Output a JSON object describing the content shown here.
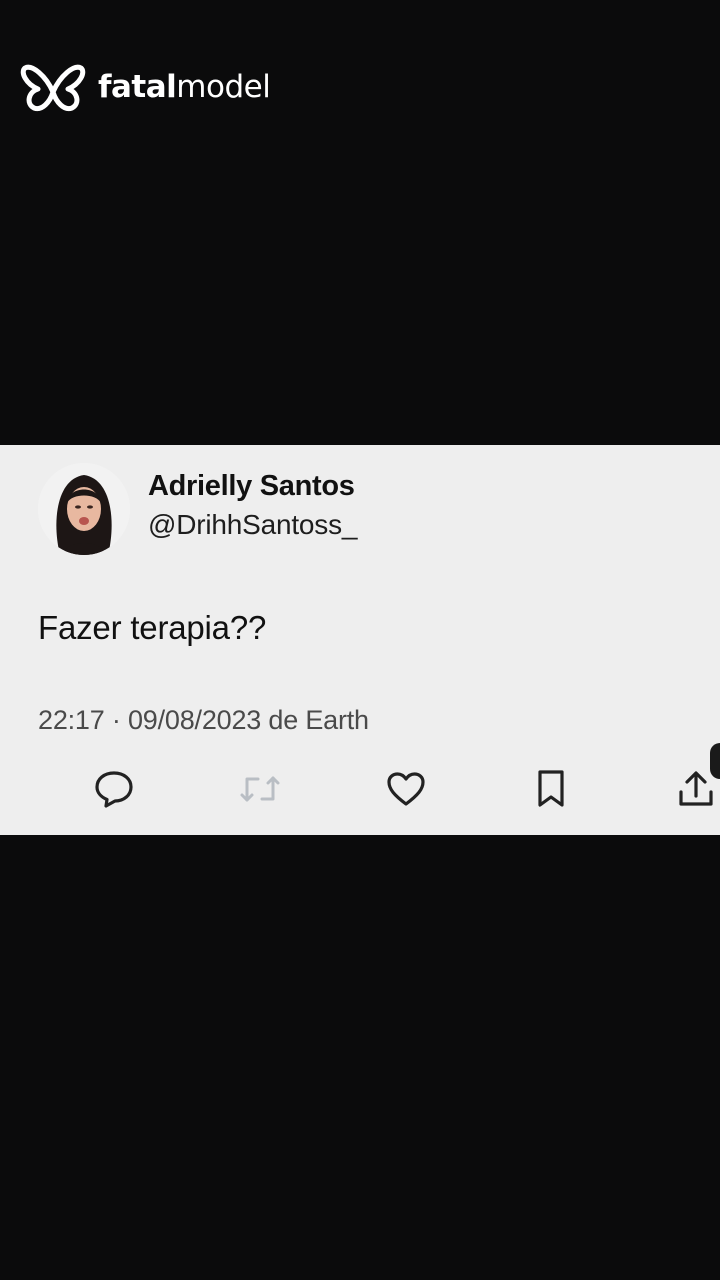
{
  "watermark": {
    "brand_bold": "fatal",
    "brand_light": "model",
    "logo_icon": "butterfly-icon"
  },
  "tweet": {
    "display_name": "Adrielly Santos",
    "handle": "@DrihhSantoss_",
    "text": "Fazer terapia??",
    "meta": "22:17 · 09/08/2023 de Earth",
    "actions": {
      "reply_icon": "reply-icon",
      "retweet_icon": "retweet-icon",
      "like_icon": "heart-icon",
      "bookmark_icon": "bookmark-icon",
      "share_icon": "share-icon"
    }
  },
  "colors": {
    "page_background": "#0b0b0c",
    "card_background": "#eeeeee",
    "text_primary": "#111111",
    "text_secondary": "#4a4a4a",
    "icon_color": "#222222",
    "retweet_icon_color": "#b9bec4"
  }
}
